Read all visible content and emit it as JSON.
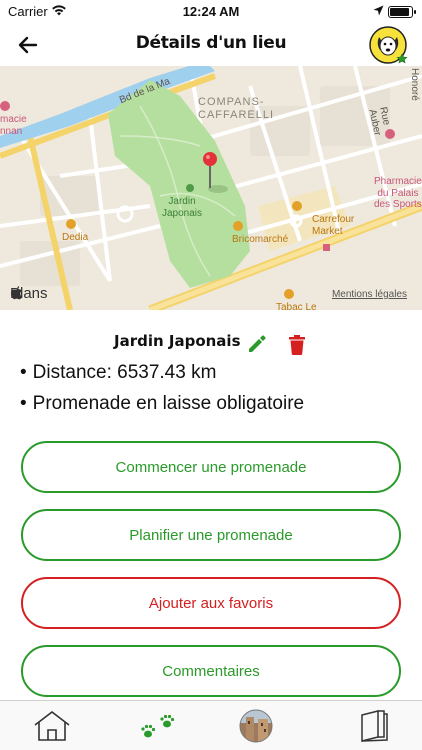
{
  "status_bar": {
    "carrier": "Carrier",
    "time": "12:24 AM"
  },
  "nav": {
    "title": "Détails d'un lieu"
  },
  "map": {
    "labels": {
      "compans": "COMPANS-\nCAFFARELLI",
      "jardin": "Jardin\nJaponais",
      "dedia": "Dedia",
      "bricomarche": "Bricomarché",
      "carrefour": "Carrefour\nMarket",
      "tabac": "Tabac Le",
      "pharmacie_left": "macie\nnnan",
      "pharmacie_right": "Pharmacie\ndu Palais\ndes Sports",
      "rue_auber": "Rue Auber",
      "bd": "Bd de la Ma",
      "honore": "Honoré"
    },
    "brand": "Plans",
    "legal": "Mentions légales"
  },
  "place": {
    "name": "Jardin Japonais",
    "distance": "Distance: 6537.43 km",
    "rule": "Promenade en laisse obligatoire"
  },
  "actions": {
    "start_walk": "Commencer une promenade",
    "plan_walk": "Planifier une promenade",
    "add_favorite": "Ajouter aux favoris",
    "comments": "Commentaires"
  },
  "colors": {
    "green": "#2a9a2a",
    "red": "#d42020",
    "park": "#b5df9e"
  }
}
